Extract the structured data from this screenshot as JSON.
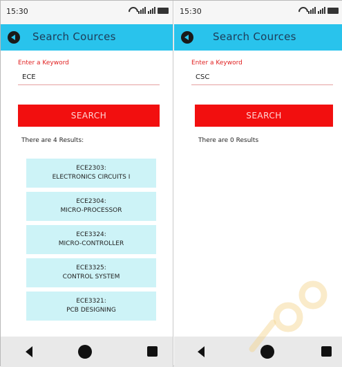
{
  "screens": [
    {
      "status_time": "15:30",
      "app_title": "Search Cources",
      "keyword_label": "Enter a Keyword",
      "keyword_value": "ECE",
      "search_label": "SEARCH",
      "results_text": "There are 4 Results:",
      "results": [
        {
          "code": "ECE2303:",
          "name": "ELECTRONICS CIRCUITS I"
        },
        {
          "code": "ECE2304:",
          "name": "MICRO-PROCESSOR"
        },
        {
          "code": "ECE3324:",
          "name": "MICRO-CONTROLLER"
        },
        {
          "code": "ECE3325:",
          "name": "CONTROL SYSTEM"
        },
        {
          "code": "ECE3321:",
          "name": "PCB DESIGNING"
        }
      ]
    },
    {
      "status_time": "15:30",
      "app_title": "Search Cources",
      "keyword_label": "Enter a Keyword",
      "keyword_value": "CSC",
      "search_label": "SEARCH",
      "results_text": "There are 0 Results",
      "results": []
    }
  ],
  "icons": {
    "status": [
      "wifi-icon",
      "signal-icon",
      "signal-icon",
      "battery-icon"
    ],
    "app_bar": "back-circle-icon",
    "navigation": [
      "nav-back-icon",
      "nav-home-icon",
      "nav-recents-icon"
    ]
  },
  "colors": {
    "app_bar": "#29c3ec",
    "search_button": "#f20f0f",
    "result_item": "#cdf3f7",
    "label_red": "#e02020"
  }
}
